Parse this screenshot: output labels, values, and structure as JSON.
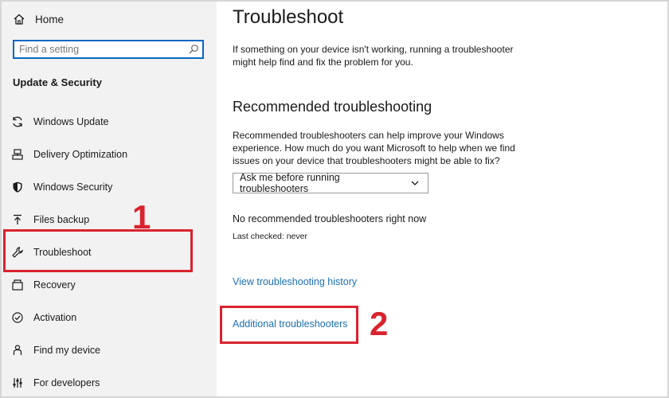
{
  "sidebar": {
    "home_label": "Home",
    "search_placeholder": "Find a setting",
    "section_title": "Update & Security",
    "items": [
      {
        "label": "Windows Update",
        "icon": "sync-icon"
      },
      {
        "label": "Delivery Optimization",
        "icon": "delivery-optimization-icon"
      },
      {
        "label": "Windows Security",
        "icon": "shield-icon"
      },
      {
        "label": "Files backup",
        "icon": "backup-arrow-icon"
      },
      {
        "label": "Troubleshoot",
        "icon": "wrench-icon"
      },
      {
        "label": "Recovery",
        "icon": "recovery-icon"
      },
      {
        "label": "Activation",
        "icon": "check-circle-icon"
      },
      {
        "label": "Find my device",
        "icon": "person-pin-icon"
      },
      {
        "label": "For developers",
        "icon": "developer-sliders-icon"
      }
    ]
  },
  "main": {
    "title": "Troubleshoot",
    "intro": "If something on your device isn't working, running a troubleshooter might help find and fix the problem for you.",
    "recommended_heading": "Recommended troubleshooting",
    "recommended_text": "Recommended troubleshooters can help improve your Windows experience. How much do you want Microsoft to help when we find issues on your device that troubleshooters might be able to fix?",
    "dropdown_value": "Ask me before running troubleshooters",
    "status_text": "No recommended troubleshooters right now",
    "last_checked": "Last checked: never",
    "history_link": "View troubleshooting history",
    "additional_link": "Additional troubleshooters"
  },
  "annotations": {
    "step1": "1",
    "step2": "2",
    "color": "#d9232f"
  },
  "colors": {
    "sidebar_bg": "#f2f2f2",
    "link": "#1b6fb5",
    "search_border": "#0a66c2"
  }
}
